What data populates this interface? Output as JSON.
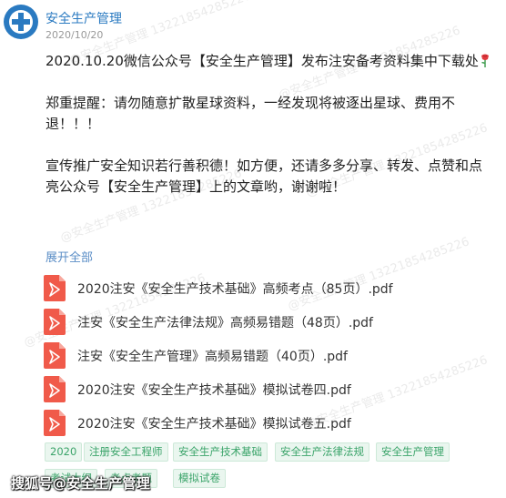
{
  "header": {
    "author": "安全生产管理",
    "date": "2020/10/20"
  },
  "post": {
    "para1": "2020.10.20微信公众号【安全生产管理】发布注安备考资料集中下载处",
    "para2": "郑重提醒：请勿随意扩散星球资料，一经发现将被逐出星球、费用不退！！！",
    "para3": "宣传推广安全知识若行善积德！如方便，还请多多分享、转发、点赞和点亮公众号【安全生产管理】上的文章哟，谢谢啦！"
  },
  "expand_label": "展开全部",
  "files": [
    {
      "name": "2020注安《安全生产技术基础》高频考点（85页）.pdf",
      "icon": "pdf-icon"
    },
    {
      "name": "注安《安全生产法律法规》高频易错题（48页）.pdf",
      "icon": "pdf-icon"
    },
    {
      "name": "注安《安全生产管理》高频易错题（40页）.pdf",
      "icon": "pdf-icon"
    },
    {
      "name": "2020注安《安全生产技术基础》模拟试卷四.pdf",
      "icon": "pdf-icon"
    },
    {
      "name": "2020注安《安全生产技术基础》模拟试卷五.pdf",
      "icon": "pdf-icon"
    }
  ],
  "tags": [
    "2020",
    "注册安全工程师",
    "安全生产技术基础",
    "安全生产法律法规",
    "安全生产管理",
    "考试大纲",
    "考点考题",
    "模拟试卷"
  ],
  "footer_watermark": "搜狐号@安全生产管理",
  "watermark_text": "@安全生产管理 13221854285226",
  "colors": {
    "accent_blue": "#2a7ac1",
    "tag_green": "#3ba46a",
    "pdf_red": "#f05a4a"
  }
}
